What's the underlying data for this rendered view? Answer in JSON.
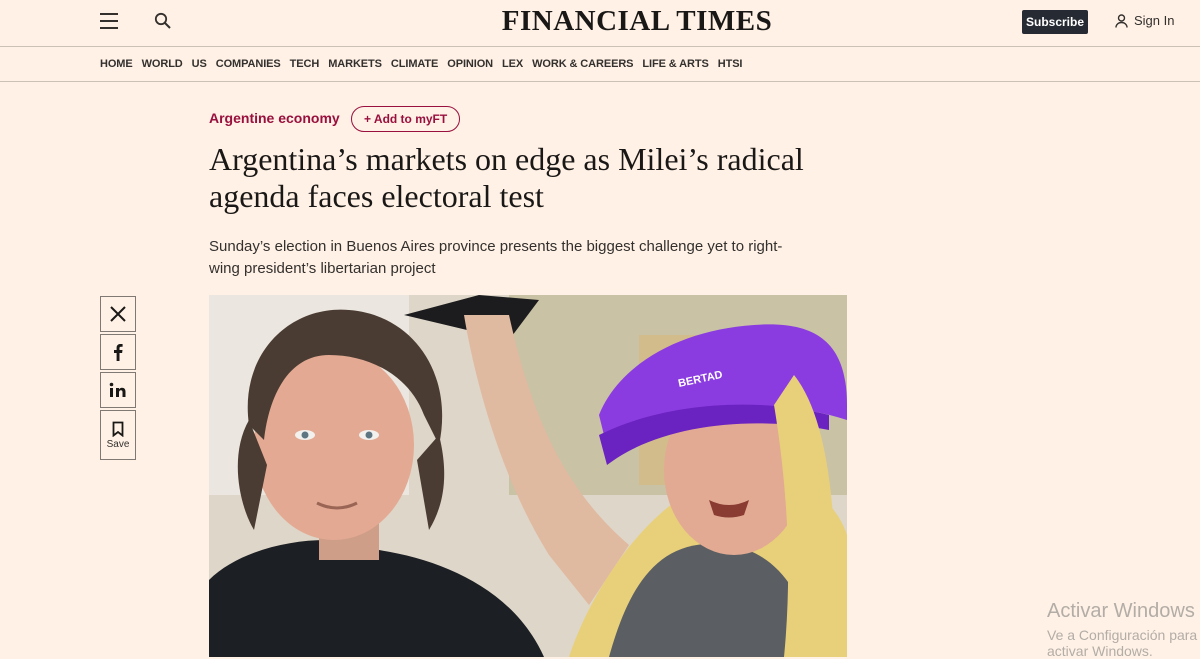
{
  "header": {
    "logo": "FINANCIAL TIMES",
    "subscribe_label": "Subscribe",
    "signin_label": "Sign In"
  },
  "nav": [
    "HOME",
    "WORLD",
    "US",
    "COMPANIES",
    "TECH",
    "MARKETS",
    "CLIMATE",
    "OPINION",
    "LEX",
    "WORK & CAREERS",
    "LIFE & ARTS",
    "HTSI"
  ],
  "article": {
    "topic": "Argentine economy",
    "add_myft": "+ Add to myFT",
    "headline_line1": "Argentina’s markets on edge as Milei’s radical",
    "headline_line2": "agenda faces electoral test",
    "standfirst_line1": "Sunday’s election in Buenos Aires province presents the biggest challenge yet to right-",
    "standfirst_line2": "wing president’s libertarian project",
    "photo_cap_text": "BERTAD"
  },
  "share": {
    "save_label": "Save"
  },
  "watermark": {
    "line1": "Activar Windows",
    "line2": "Ve a Configuración para activar Windows."
  },
  "colors": {
    "background": "#fff1e5",
    "brand_claret": "#990f3d",
    "subscribe_bg": "#262a33",
    "cap_purple": "#8a3ce0"
  }
}
